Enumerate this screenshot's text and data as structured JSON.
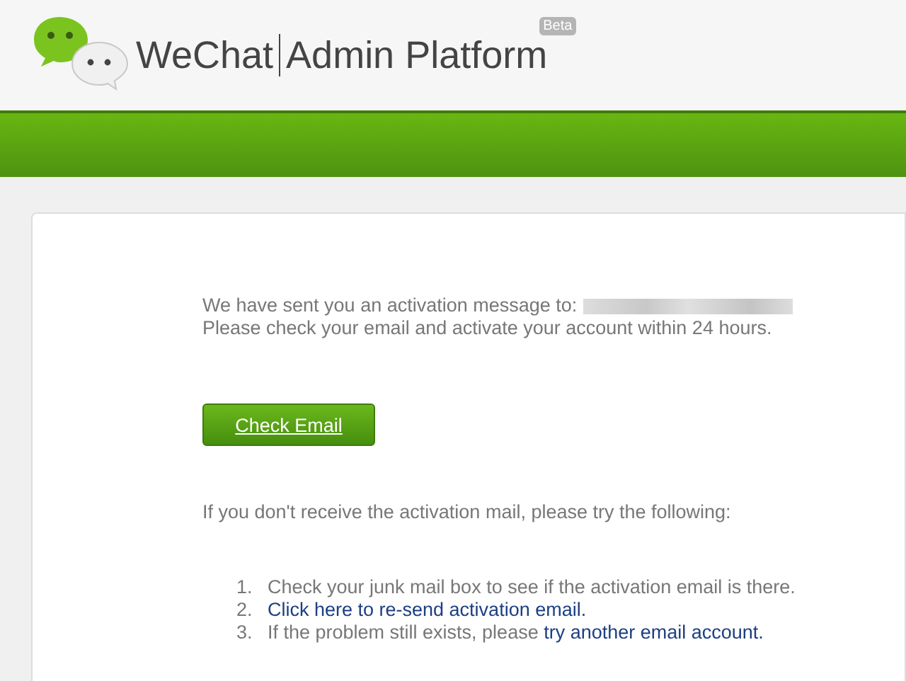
{
  "header": {
    "brand": "WeChat",
    "product": "Admin Platform",
    "badge": "Beta"
  },
  "message": {
    "lines": [
      "We have sent you an activation message to:",
      "Please check your email and activate your account within 24 hours."
    ],
    "email_redacted": true
  },
  "button": {
    "label": "Check Email"
  },
  "help": {
    "intro": "If you don't receive the activation mail, please try the following:",
    "items": [
      {
        "number": "1.",
        "text": "Check your junk mail box to see if the activation email is there."
      },
      {
        "number": "2.",
        "link": "Click here to re-send activation email."
      },
      {
        "number": "3.",
        "text": "If the problem still exists, please ",
        "link": "try another email account."
      }
    ]
  }
}
